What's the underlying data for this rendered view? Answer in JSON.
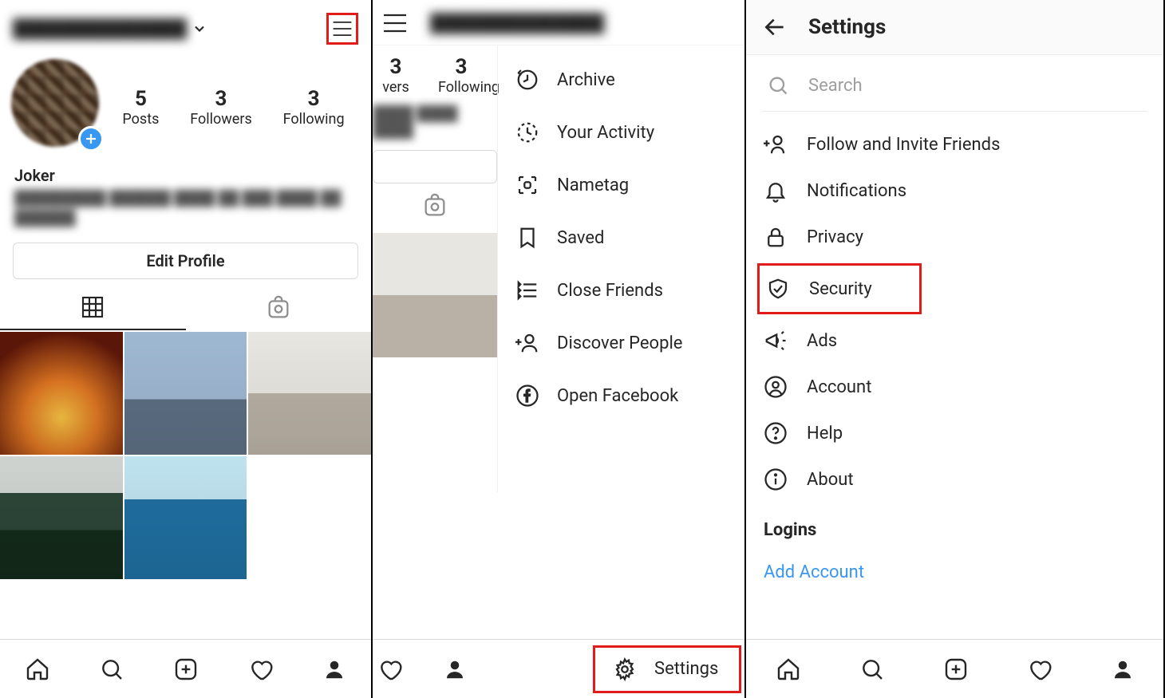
{
  "panel1": {
    "username": "██████████████",
    "bio_name": "Joker",
    "bio_text": "█████████ ██████ ████ ██ ███ ████ ██ ██████.",
    "edit_button": "Edit Profile",
    "stats": [
      {
        "num": "5",
        "label": "Posts"
      },
      {
        "num": "3",
        "label": "Followers"
      },
      {
        "num": "3",
        "label": "Following"
      }
    ]
  },
  "panel2": {
    "username": "██████████████",
    "stats_partial": [
      {
        "num": "3",
        "label": "vers"
      },
      {
        "num": "3",
        "label": "Following"
      }
    ],
    "bio_text": "████ ████ ████",
    "menu": [
      {
        "icon": "archive-icon",
        "label": "Archive"
      },
      {
        "icon": "activity-icon",
        "label": "Your Activity"
      },
      {
        "icon": "nametag-icon",
        "label": "Nametag"
      },
      {
        "icon": "bookmark-icon",
        "label": "Saved"
      },
      {
        "icon": "close-friends-icon",
        "label": "Close Friends"
      },
      {
        "icon": "discover-people-icon",
        "label": "Discover People"
      },
      {
        "icon": "facebook-icon",
        "label": "Open Facebook"
      }
    ],
    "settings_label": "Settings"
  },
  "panel3": {
    "title": "Settings",
    "search_placeholder": "Search",
    "items": [
      {
        "icon": "add-friend-icon",
        "label": "Follow and Invite Friends"
      },
      {
        "icon": "bell-icon",
        "label": "Notifications"
      },
      {
        "icon": "lock-icon",
        "label": "Privacy"
      },
      {
        "icon": "shield-icon",
        "label": "Security",
        "highlighted": true
      },
      {
        "icon": "megaphone-icon",
        "label": "Ads"
      },
      {
        "icon": "person-circle-icon",
        "label": "Account"
      },
      {
        "icon": "help-icon",
        "label": "Help"
      },
      {
        "icon": "info-icon",
        "label": "About"
      }
    ],
    "logins_label": "Logins",
    "add_account": "Add Account"
  },
  "colors": {
    "highlight": "#e21b1b",
    "link": "#3897f0"
  }
}
